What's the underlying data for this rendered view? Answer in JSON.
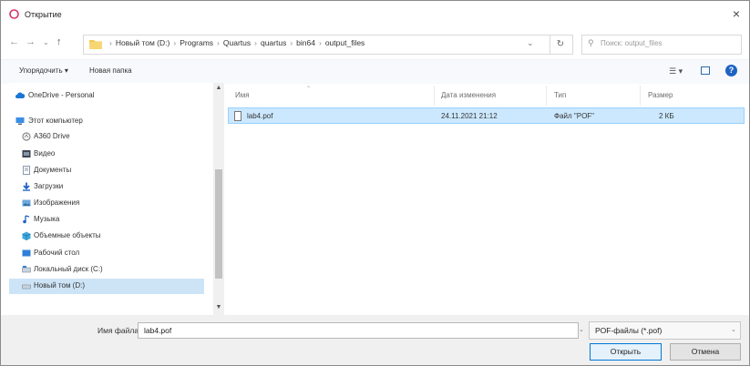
{
  "window": {
    "title": "Открытие",
    "close_glyph": "×",
    "accent_color": "#0078d7"
  },
  "address_bar": {
    "back_glyph": "←",
    "forward_glyph": "→",
    "up_recent_glyph": "⌄",
    "up_glyph": "↑",
    "breadcrumb": [
      "Новый том (D:)",
      "Programs",
      "Quartus",
      "quartus",
      "bin64",
      "output_files"
    ],
    "dropdown_glyph": "⌄",
    "refresh_glyph": "↻",
    "search_placeholder": "Поиск: output_files"
  },
  "toolbar": {
    "organize_label": "Упорядочить ▾",
    "new_folder_label": "Новая папка",
    "view_glyph": "☰ ▾"
  },
  "nav_pane": {
    "items": [
      {
        "label": "OneDrive - Personal",
        "icon": "cloud-icon"
      },
      {
        "label": "Этот компьютер",
        "icon": "computer-icon"
      },
      {
        "label": "A360 Drive",
        "icon": "a360-drive-icon"
      },
      {
        "label": "Видео",
        "icon": "video-folder-icon"
      },
      {
        "label": "Документы",
        "icon": "documents-folder-icon"
      },
      {
        "label": "Загрузки",
        "icon": "downloads-folder-icon"
      },
      {
        "label": "Изображения",
        "icon": "pictures-folder-icon"
      },
      {
        "label": "Музыка",
        "icon": "music-folder-icon"
      },
      {
        "label": "Объемные объекты",
        "icon": "3d-objects-folder-icon"
      },
      {
        "label": "Рабочий стол",
        "icon": "desktop-folder-icon"
      },
      {
        "label": "Локальный диск (C:)",
        "icon": "drive-icon"
      },
      {
        "label": "Новый том (D:)",
        "icon": "drive-icon"
      }
    ],
    "selected_index": 11
  },
  "file_list": {
    "columns": [
      "Имя",
      "Дата изменения",
      "Тип",
      "Размер"
    ],
    "rows": [
      {
        "name": "lab4.pof",
        "modified": "24.11.2021 21:12",
        "type": "Файл \"POF\"",
        "size": "2 КБ"
      }
    ]
  },
  "bottom": {
    "filename_label": "Имя файла:",
    "filename_value": "lab4.pof",
    "filter_value": "POF-файлы (*.pof)",
    "open_label": "Открыть",
    "cancel_label": "Отмена"
  }
}
